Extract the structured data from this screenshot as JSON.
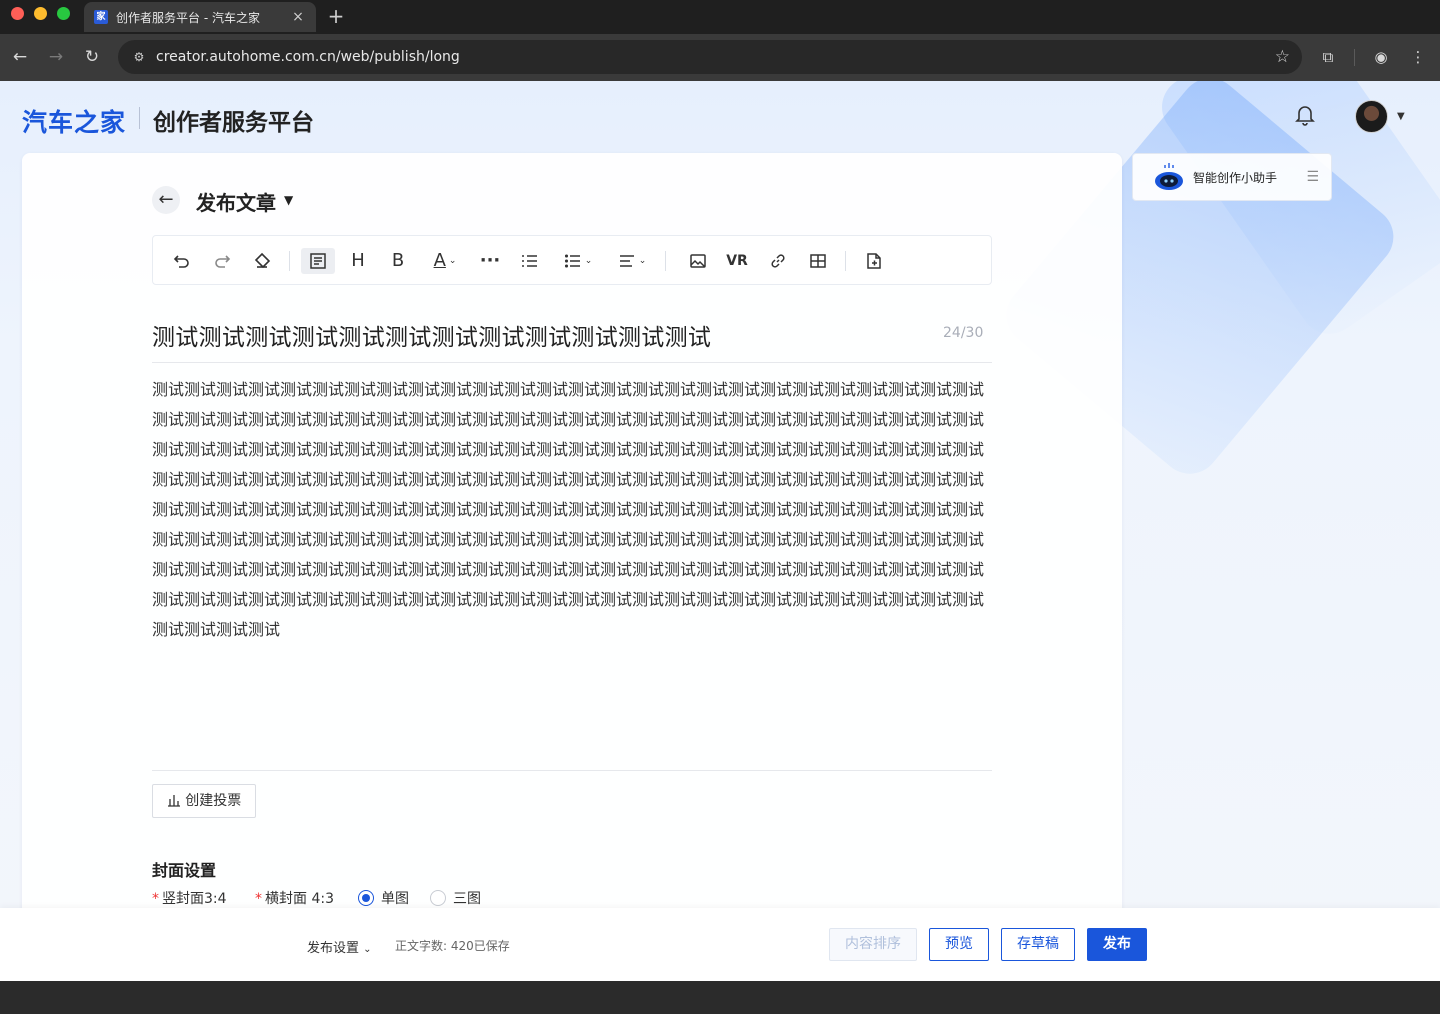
{
  "browser": {
    "tab_title": "创作者服务平台 - 汽车之家",
    "tab_favicon": "家",
    "url": "creator.autohome.com.cn/web/publish/long",
    "new_tab_label": "+",
    "close_label": "×"
  },
  "header": {
    "logo": "汽车之家",
    "platform_name": "创作者服务平台"
  },
  "editor": {
    "back_label": "←",
    "page_title": "发布文章",
    "toolbar": [
      {
        "name": "undo-icon"
      },
      {
        "name": "redo-icon"
      },
      {
        "name": "eraser-icon"
      },
      {
        "name": "paragraph-icon"
      },
      {
        "name": "heading-icon",
        "label": "H"
      },
      {
        "name": "bold-icon",
        "label": "B"
      },
      {
        "name": "font-color-icon",
        "label": "A"
      },
      {
        "name": "more-icon",
        "label": "···"
      },
      {
        "name": "ordered-list-icon"
      },
      {
        "name": "unordered-list-icon"
      },
      {
        "name": "align-icon"
      },
      {
        "name": "image-icon"
      },
      {
        "name": "vr-icon",
        "label": "VR"
      },
      {
        "name": "link-icon"
      },
      {
        "name": "table-icon"
      },
      {
        "name": "document-icon"
      }
    ],
    "title": "测试测试测试测试测试测试测试测试测试测试测试测试",
    "title_counter": "24/30",
    "body": "测试测试测试测试测试测试测试测试测试测试测试测试测试测试测试测试测试测试测试测试测试测试测试测试测试测试测试测试测试测试测试测试测试测试测试测试测试测试测试测试测试测试测试测试测试测试测试测试测试测试测试测试测试测试测试测试测试测试测试测试测试测试测试测试测试测试测试测试测试测试测试测试测试测试测试测试测试测试测试测试测试测试测试测试测试测试测试测试测试测试测试测试测试测试测试测试测试测试测试测试测试测试测试测试测试测试测试测试测试测试测试测试测试测试测试测试测试测试测试测试测试测试测试测试测试测试测试测试测试测试测试测试测试测试测试测试测试测试测试测试测试测试测试测试测试测试测试测试测试测试测试测试测试测试测试测试测试测试测试测试测试测试测试测试测试测试测试测试测试测试测试测试测试测试测试测试测试测试测试测试测试测试测试测试测试测试测试测试测试测试测试测试测试测试测试测试测试测试测试测试测试测试测试测试测试测试测试测试测试测试测试测试",
    "vote_button": "创建投票",
    "cover_section_title": "封面设置",
    "cover_vertical": "竖封面3:4",
    "cover_horizontal": "横封面 4:3",
    "cover_mode_single": "单图",
    "cover_mode_triple": "三图",
    "cover_mode_selected": "单图"
  },
  "assistant": {
    "label": "智能创作小助手"
  },
  "bottom_bar": {
    "publish_settings": "发布设置",
    "word_count": "正文字数:  420已保存",
    "sort_button": "内容排序",
    "preview_button": "预览",
    "draft_button": "存草稿",
    "publish_button": "发布"
  },
  "colors": {
    "brand": "#1a56db",
    "required": "#e33333"
  }
}
